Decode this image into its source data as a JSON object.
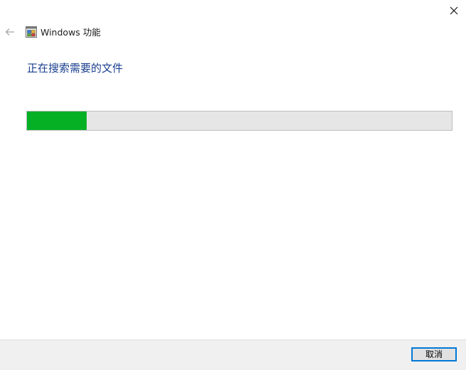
{
  "window": {
    "title": "Windows 功能",
    "close_icon": "close-icon",
    "back_icon": "back-arrow-icon",
    "app_icon": "windows-features-icon"
  },
  "main": {
    "status_title": "正在搜索需要的文件",
    "progress": {
      "fraction": 0.14,
      "fill_color": "#06b025",
      "track_color": "#e6e6e6"
    }
  },
  "footer": {
    "cancel_label": "取消"
  },
  "colors": {
    "title_text": "#1a3f8f",
    "button_focus_border": "#0078d7"
  }
}
